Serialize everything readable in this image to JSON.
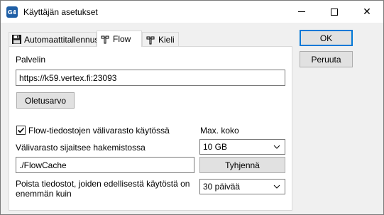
{
  "window": {
    "app_icon_text": "G4",
    "title": "Käyttäjän asetukset",
    "minimize": "minimize",
    "maximize": "maximize",
    "close": "✕"
  },
  "tabs": [
    {
      "label": "Automaattitallennus",
      "icon": "floppy-disk-icon"
    },
    {
      "label": "Flow",
      "icon": "tools-icon"
    },
    {
      "label": "Kieli",
      "icon": "tools-icon"
    }
  ],
  "active_tab": "Flow",
  "flow": {
    "server_label": "Palvelin",
    "server_value": "https://k59.vertex.fi:23093",
    "default_button": "Oletusarvo",
    "cache_checkbox_label": "Flow-tiedostojen välivarasto käytössä",
    "cache_checkbox_checked": true,
    "max_size_label": "Max. koko",
    "max_size_value": "10 GB",
    "cache_dir_label": "Välivarasto sijaitsee hakemistossa",
    "cache_dir_value": "./FlowCache",
    "clear_button": "Tyhjennä",
    "delete_label_line1": "Poista tiedostot, joiden edellisestä käytöstä on",
    "delete_label_line2": "enemmän kuin",
    "delete_age_value": "30 päivää"
  },
  "dialog_buttons": {
    "ok": "OK",
    "cancel": "Peruuta"
  }
}
